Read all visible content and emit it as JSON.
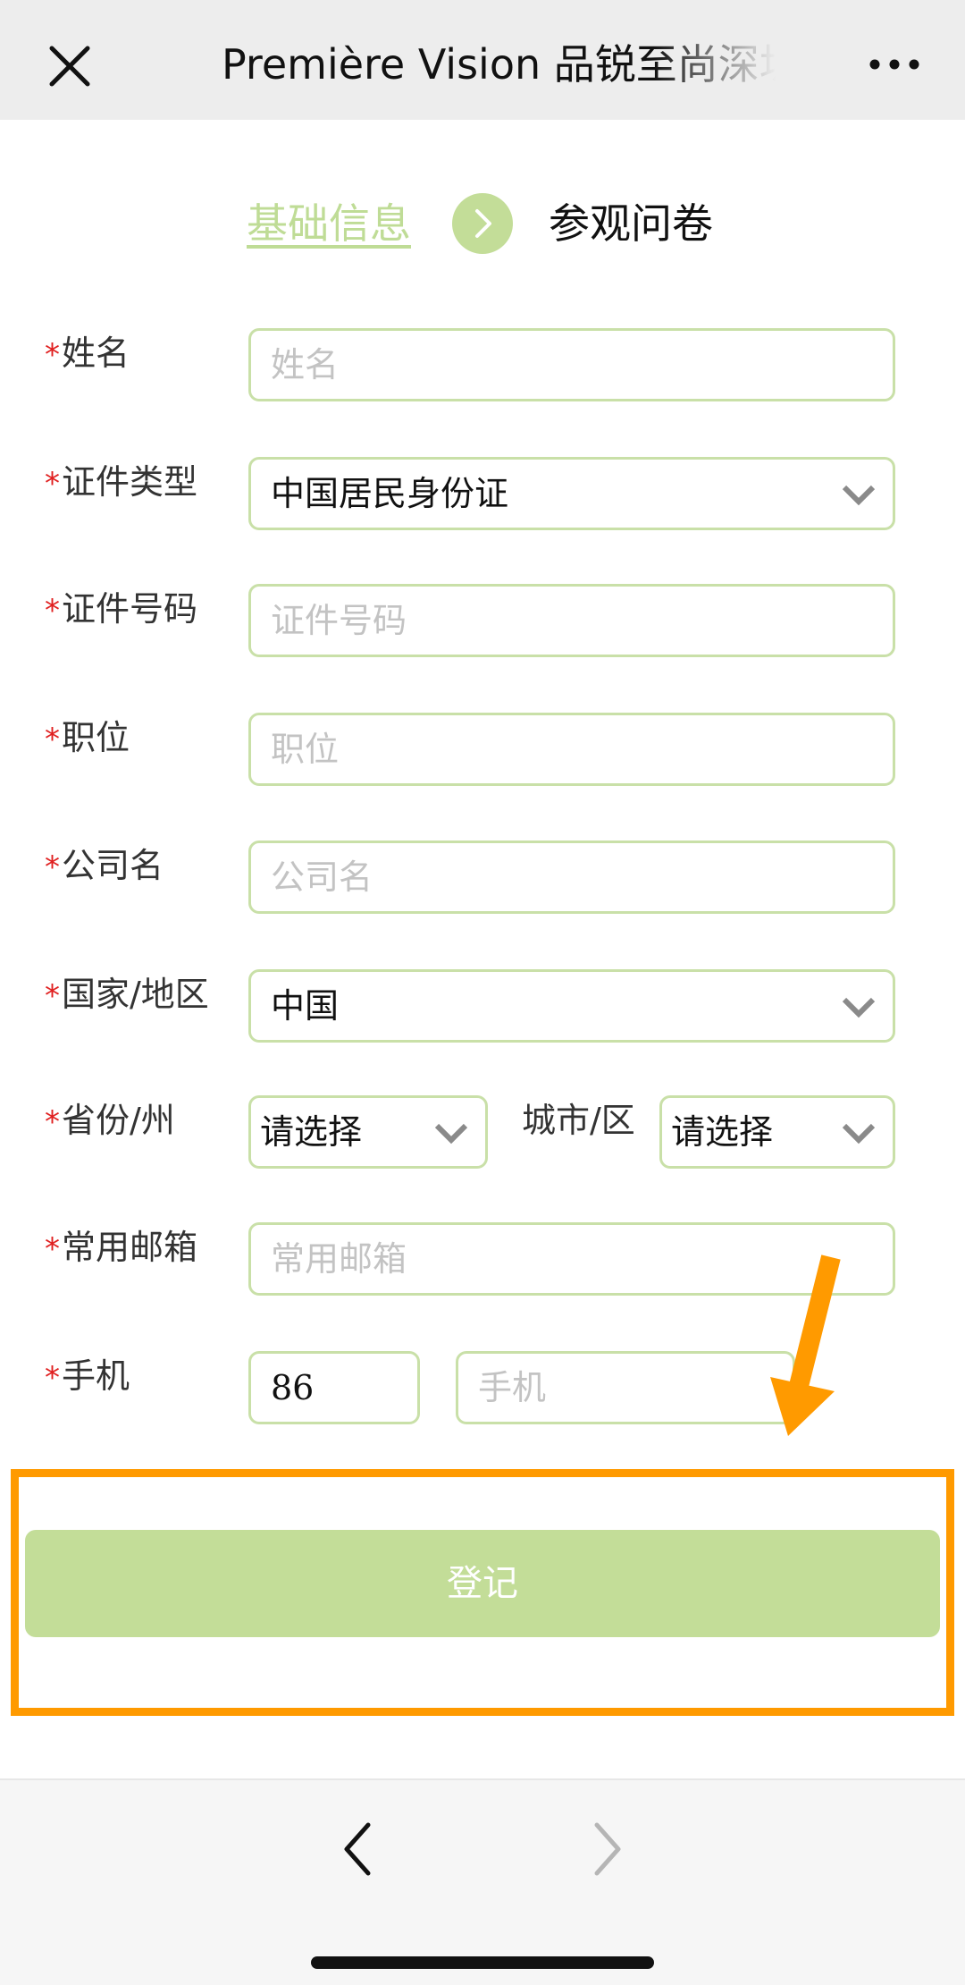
{
  "header": {
    "title": "Première Vision 品锐至尚深圳"
  },
  "steps": {
    "step1": "基础信息",
    "step2": "参观问卷"
  },
  "form": {
    "name": {
      "label": "姓名",
      "placeholder": "姓名"
    },
    "id_type": {
      "label": "证件类型",
      "value": "中国居民身份证"
    },
    "id_number": {
      "label": "证件号码",
      "placeholder": "证件号码"
    },
    "position": {
      "label": "职位",
      "placeholder": "职位"
    },
    "company": {
      "label": "公司名",
      "placeholder": "公司名"
    },
    "country": {
      "label": "国家/地区",
      "value": "中国"
    },
    "province": {
      "label": "省份/州",
      "value": "请选择"
    },
    "city": {
      "label": "城市/区",
      "value": "请选择"
    },
    "email": {
      "label": "常用邮箱",
      "placeholder": "常用邮箱"
    },
    "mobile": {
      "label": "手机",
      "code": "86",
      "placeholder": "手机"
    },
    "required_mark": "*"
  },
  "submit": {
    "label": "登记"
  },
  "colors": {
    "accent": "#c3dd98",
    "required": "#e02020",
    "highlight": "#ff9a00"
  }
}
